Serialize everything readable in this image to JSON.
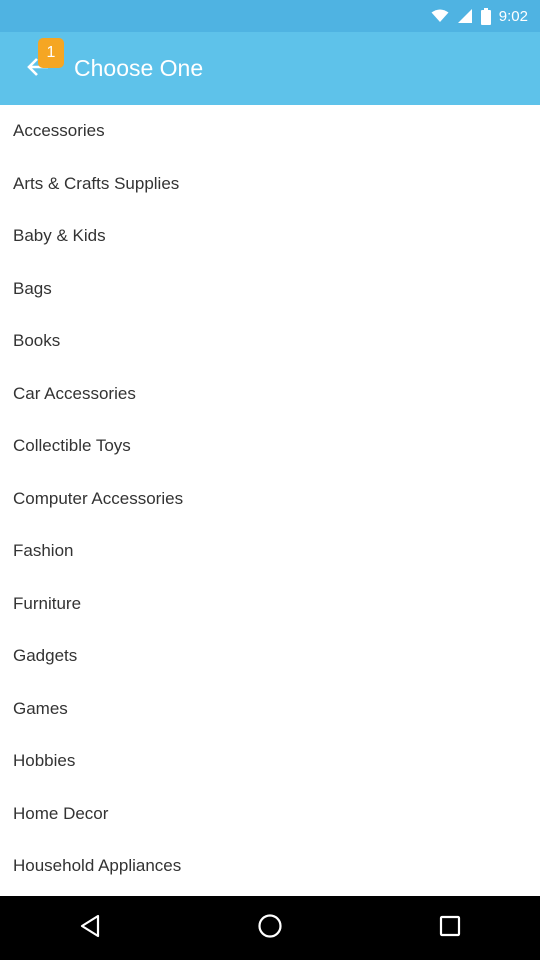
{
  "status_bar": {
    "time": "9:02"
  },
  "header": {
    "title": "Choose One",
    "notification_count": "1"
  },
  "categories": [
    "Accessories",
    "Arts & Crafts Supplies",
    "Baby & Kids",
    "Bags",
    "Books",
    "Car Accessories",
    "Collectible Toys",
    "Computer Accessories",
    "Fashion",
    "Furniture",
    "Gadgets",
    "Games",
    "Hobbies",
    "Home Decor",
    "Household Appliances"
  ],
  "icons": {
    "back": "arrow-left-icon",
    "wifi": "wifi-icon",
    "signal": "cell-signal-icon",
    "battery": "battery-icon",
    "nav_back": "nav-back-icon",
    "nav_home": "nav-home-icon",
    "nav_recents": "nav-recents-icon"
  },
  "colors": {
    "app_bar": "#5ec2ea",
    "status_bar": "#4fb3e2",
    "badge": "#f5a623"
  }
}
